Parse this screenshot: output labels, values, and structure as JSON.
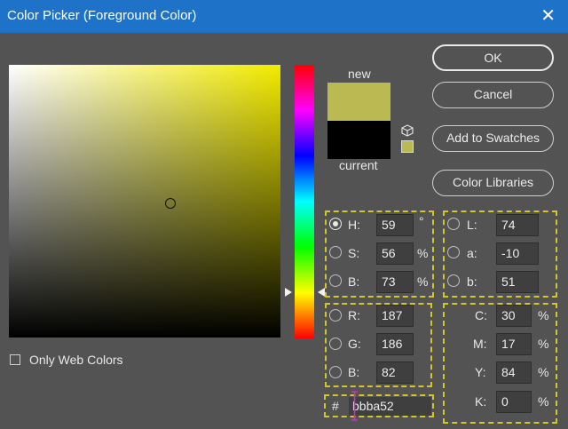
{
  "window": {
    "title": "Color Picker (Foreground Color)",
    "close_glyph": "✕"
  },
  "preview": {
    "new_label": "new",
    "current_label": "current",
    "new_color": "#bbba52",
    "current_color": "#000000"
  },
  "buttons": {
    "ok": "OK",
    "cancel": "Cancel",
    "add_to_swatches": "Add to Swatches",
    "color_libraries": "Color Libraries"
  },
  "options": {
    "only_web_colors_label": "Only Web Colors",
    "only_web_colors_checked": false
  },
  "hsb": {
    "h": {
      "label": "H:",
      "value": "59",
      "unit": "°",
      "selected": true
    },
    "s": {
      "label": "S:",
      "value": "56",
      "unit": "%"
    },
    "b": {
      "label": "B:",
      "value": "73",
      "unit": "%"
    }
  },
  "lab": {
    "l": {
      "label": "L:",
      "value": "74"
    },
    "a": {
      "label": "a:",
      "value": "-10"
    },
    "b": {
      "label": "b:",
      "value": "51"
    }
  },
  "rgb": {
    "r": {
      "label": "R:",
      "value": "187"
    },
    "g": {
      "label": "G:",
      "value": "186"
    },
    "b": {
      "label": "B:",
      "value": "82"
    }
  },
  "cmyk": {
    "c": {
      "label": "C:",
      "value": "30",
      "unit": "%"
    },
    "m": {
      "label": "M:",
      "value": "17",
      "unit": "%"
    },
    "y": {
      "label": "Y:",
      "value": "84",
      "unit": "%"
    },
    "k": {
      "label": "K:",
      "value": "0",
      "unit": "%"
    }
  },
  "hex": {
    "hash": "#",
    "value": "bbba52"
  },
  "colors": {
    "accent_title_bar": "#1e73c8",
    "group_outline": "#d4c628",
    "caret": "#c832c8"
  }
}
